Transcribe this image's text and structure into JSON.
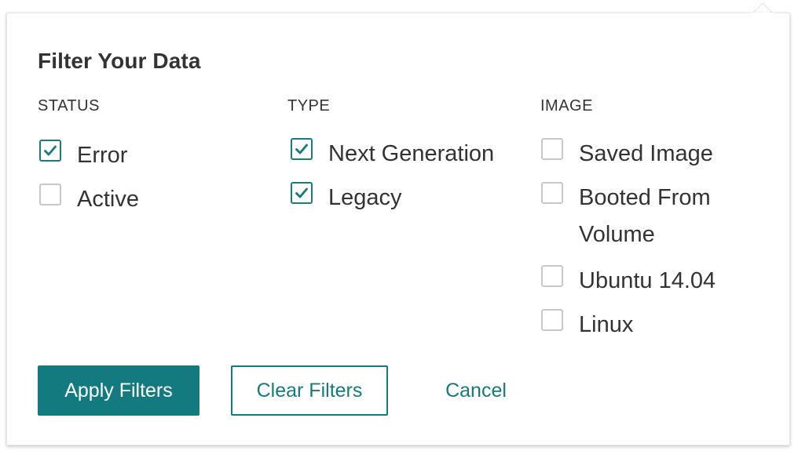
{
  "dialog": {
    "title": "Filter Your Data"
  },
  "status": {
    "heading": "STATUS",
    "options": [
      {
        "label": "Error",
        "checked": true
      },
      {
        "label": "Active",
        "checked": false
      }
    ]
  },
  "type": {
    "heading": "TYPE",
    "options": [
      {
        "label": "Next Generation",
        "checked": true
      },
      {
        "label": "Legacy",
        "checked": true
      }
    ]
  },
  "image": {
    "heading": "IMAGE",
    "options": [
      {
        "label": "Saved Image",
        "checked": false
      },
      {
        "label_line1": "Booted From",
        "label_line2": "Volume",
        "checked": false
      },
      {
        "label": "Ubuntu 14.04",
        "checked": false
      },
      {
        "label": "Linux",
        "checked": false
      }
    ]
  },
  "actions": {
    "apply_label": "Apply Filters",
    "clear_label": "Clear Filters",
    "cancel_label": "Cancel"
  },
  "colors": {
    "accent": "#137a7f",
    "text": "#333333",
    "checkbox_border": "#c8c8c8"
  },
  "icons": {
    "checked": "checkmark-icon"
  }
}
